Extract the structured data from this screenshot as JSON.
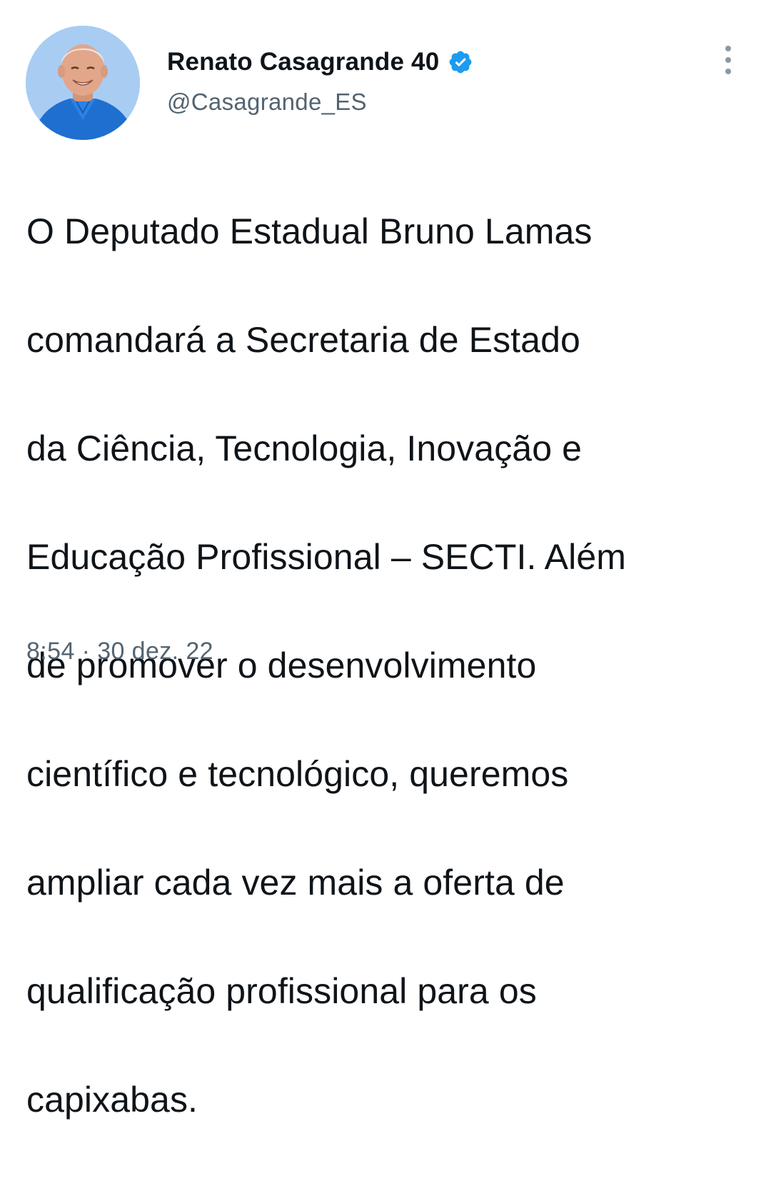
{
  "tweet": {
    "author": {
      "display_name": "Renato Casagrande 40",
      "handle": "@Casagrande_ES",
      "verified": true,
      "avatar_icon": "profile-photo"
    },
    "text_lines": [
      "O Deputado Estadual Bruno Lamas",
      "comandará a Secretaria de Estado",
      "da Ciência, Tecnologia, Inovação e",
      "Educação Profissional – SECTI. Além",
      "de promover o desenvolvimento",
      "científico e tecnológico, queremos",
      "ampliar cada vez mais a oferta de",
      "qualificação profissional para os",
      "capixabas."
    ],
    "timestamp": "8:54 · 30 dez. 22",
    "more_icon": "more-vertical-icon"
  },
  "colors": {
    "text": "#0f1419",
    "secondary_text": "#536471",
    "verified_badge": "#1d9bf0",
    "more_dots": "#8b98a5",
    "background": "#ffffff"
  }
}
